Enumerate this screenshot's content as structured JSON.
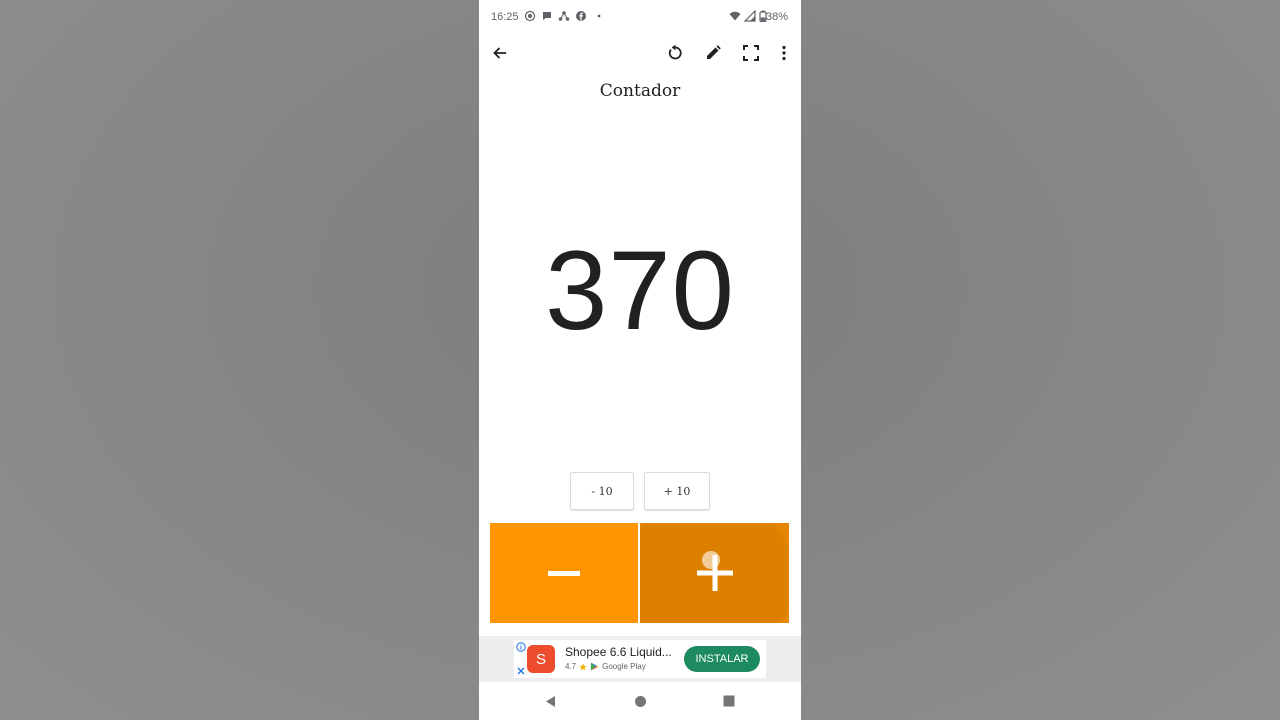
{
  "status_bar": {
    "time": "16:25",
    "battery": "38%",
    "notification_icons": [
      "screen-record-icon",
      "chat-bubble-icon",
      "network-share-icon",
      "facebook-icon",
      "dot-icon"
    ],
    "system_icons": [
      "wifi-icon",
      "signal-icon",
      "battery-icon"
    ]
  },
  "toolbar": {
    "back_icon": "arrow-left-icon",
    "reset_icon": "reset-icon",
    "edit_icon": "pencil-icon",
    "fullscreen_icon": "fullscreen-icon",
    "menu_icon": "more-vertical-icon"
  },
  "counter": {
    "title": "Contador",
    "value": "370",
    "minus_ten_label": "- 10",
    "plus_ten_label": "+ 10",
    "decrement_symbol": "−",
    "increment_symbol": "+"
  },
  "ad": {
    "app_name": "Shopee 6.6 Liquid...",
    "rating": "4.7",
    "store": "Google Play",
    "install_label": "INSTALAR",
    "logo_letter": "S"
  },
  "nav": {
    "back": "nav-back-icon",
    "home": "nav-home-icon",
    "recents": "nav-recents-icon"
  },
  "colors": {
    "accent_orange": "#ff9500",
    "accent_orange_pressed": "#e68600",
    "install_green": "#1e8a5f",
    "shopee_red": "#ee4d2d"
  }
}
